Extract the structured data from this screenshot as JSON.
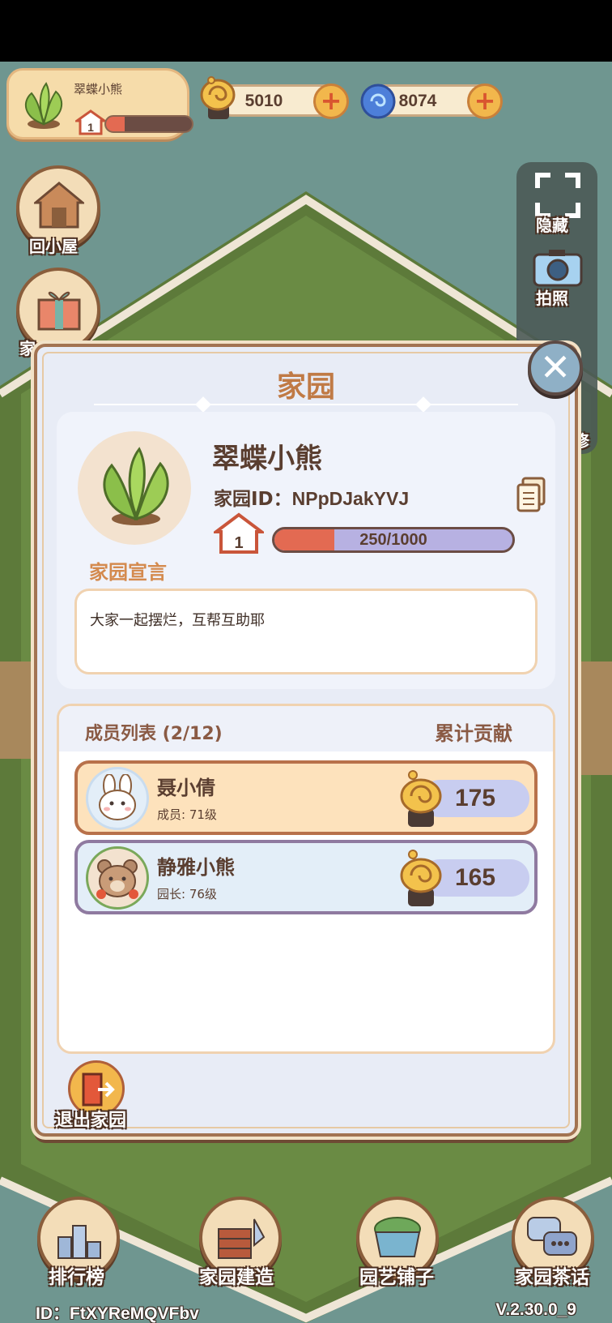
{
  "hud": {
    "player_name": "翠蝶小熊",
    "player_level": "1",
    "player_progress": 0.22,
    "snail_coins": "5010",
    "blue_gems": "8074"
  },
  "side": {
    "home_label": "回小屋",
    "gift_label": "家",
    "hide_label": "隐藏",
    "photo_label": "拍照",
    "decorate_label": "修"
  },
  "modal": {
    "title": "家园",
    "garden_name": "翠蝶小熊",
    "garden_id_label": "家园ID：",
    "garden_id": "NPpDJakYVJ",
    "garden_level": "1",
    "exp_text": "250/1000",
    "exp_progress": 0.25,
    "declaration_label": "家园宣言",
    "declaration_text": "大家一起摆烂，互帮互助耶",
    "members_title": "成员列表 (2/12)",
    "contribution_title": "累计贡献",
    "members": [
      {
        "name": "聂小倩",
        "role": "成员: 71级",
        "score": "175",
        "avatar": "bunny-avatar"
      },
      {
        "name": "静雅小熊",
        "role": "园长: 76级",
        "score": "165",
        "avatar": "bear-avatar"
      }
    ],
    "exit_label": "退出家园",
    "close_icon": "close-icon"
  },
  "nav": {
    "ranking": "排行榜",
    "build": "家园建造",
    "shop": "园艺铺子",
    "chat": "家园茶话"
  },
  "footer": {
    "id_text": "ID：FtXYReMQVFbv",
    "version": "V.2.30.0_9"
  },
  "colors": {
    "accent_orange": "#d48a4e",
    "progress_red": "#e36a52",
    "modal_bg": "#e8ecf6",
    "frame_brown": "#a27352"
  }
}
